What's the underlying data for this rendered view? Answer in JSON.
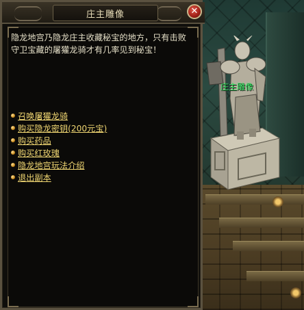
{
  "dialog": {
    "title": "庄主雕像",
    "close_label": "✕",
    "description": "隐龙地宫乃隐龙庄主收藏秘宝的地方，只有击败守卫宝藏的屠獾龙骑才有几率见到秘宝！",
    "menu": [
      {
        "label": "召唤屠獾龙骑"
      },
      {
        "label": "购买隐龙密钥(200元宝)"
      },
      {
        "label": "购买药品"
      },
      {
        "label": "购买红玫瑰"
      },
      {
        "label": "隐龙地宫玩法介绍"
      },
      {
        "label": "退出副本"
      }
    ]
  },
  "world": {
    "npc_name": "庄主雕像"
  },
  "colors": {
    "menu_link": "#f0d672",
    "body_text": "#e6e0c8",
    "npc_name": "#39f26a"
  }
}
